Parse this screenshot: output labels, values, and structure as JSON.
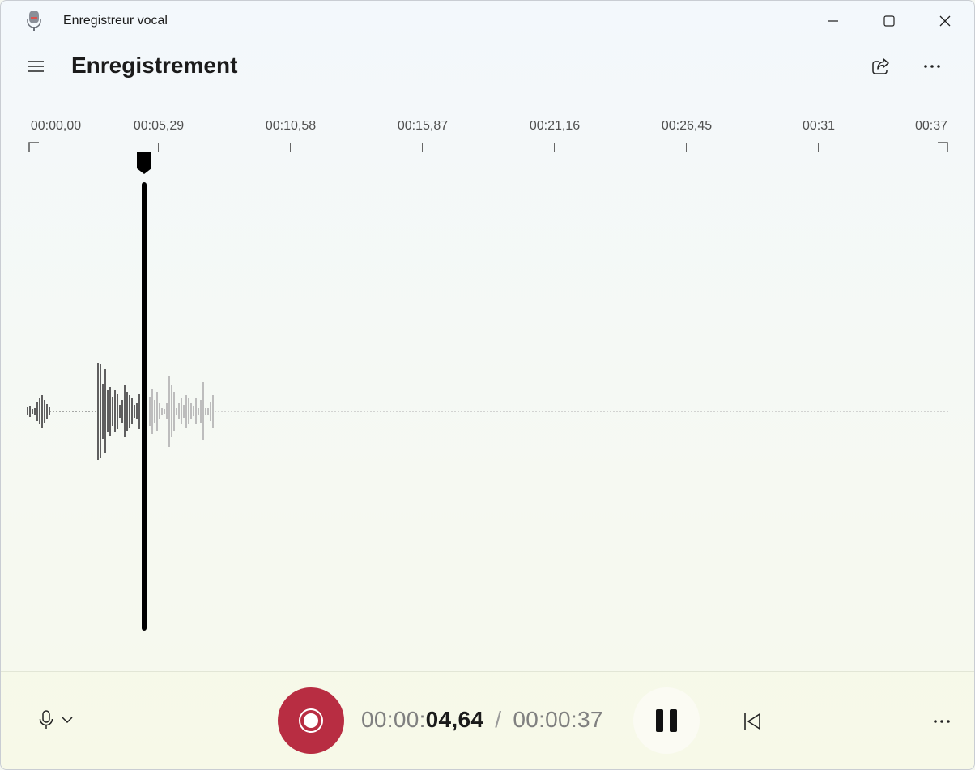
{
  "window": {
    "title": "Enregistreur vocal",
    "icon": "microphone-app-icon"
  },
  "header": {
    "title": "Enregistrement",
    "menu_icon": "hamburger-icon",
    "share_icon": "share-icon",
    "more_icon": "more-horizontal-icon"
  },
  "timeline": {
    "ticks": [
      "00:00,00",
      "00:05,29",
      "00:10,58",
      "00:15,87",
      "00:21,16",
      "00:26,45",
      "00:31",
      "00:37"
    ]
  },
  "playback": {
    "current_prefix": "00:00:",
    "current_strong": "04,64",
    "separator": "/",
    "total": "00:00:37",
    "position_fraction": 0.125
  },
  "controls": {
    "mic_icon": "microphone-icon",
    "mic_dropdown_icon": "chevron-down-icon",
    "record_icon": "record-icon",
    "pause_icon": "pause-icon",
    "skip_back_icon": "skip-to-start-icon",
    "more_icon": "more-horizontal-icon"
  },
  "colors": {
    "record": "#b82d42",
    "played_wave": "#5f5f5f",
    "unplayed_wave": "#bdbdbd",
    "playhead": "#000000"
  }
}
